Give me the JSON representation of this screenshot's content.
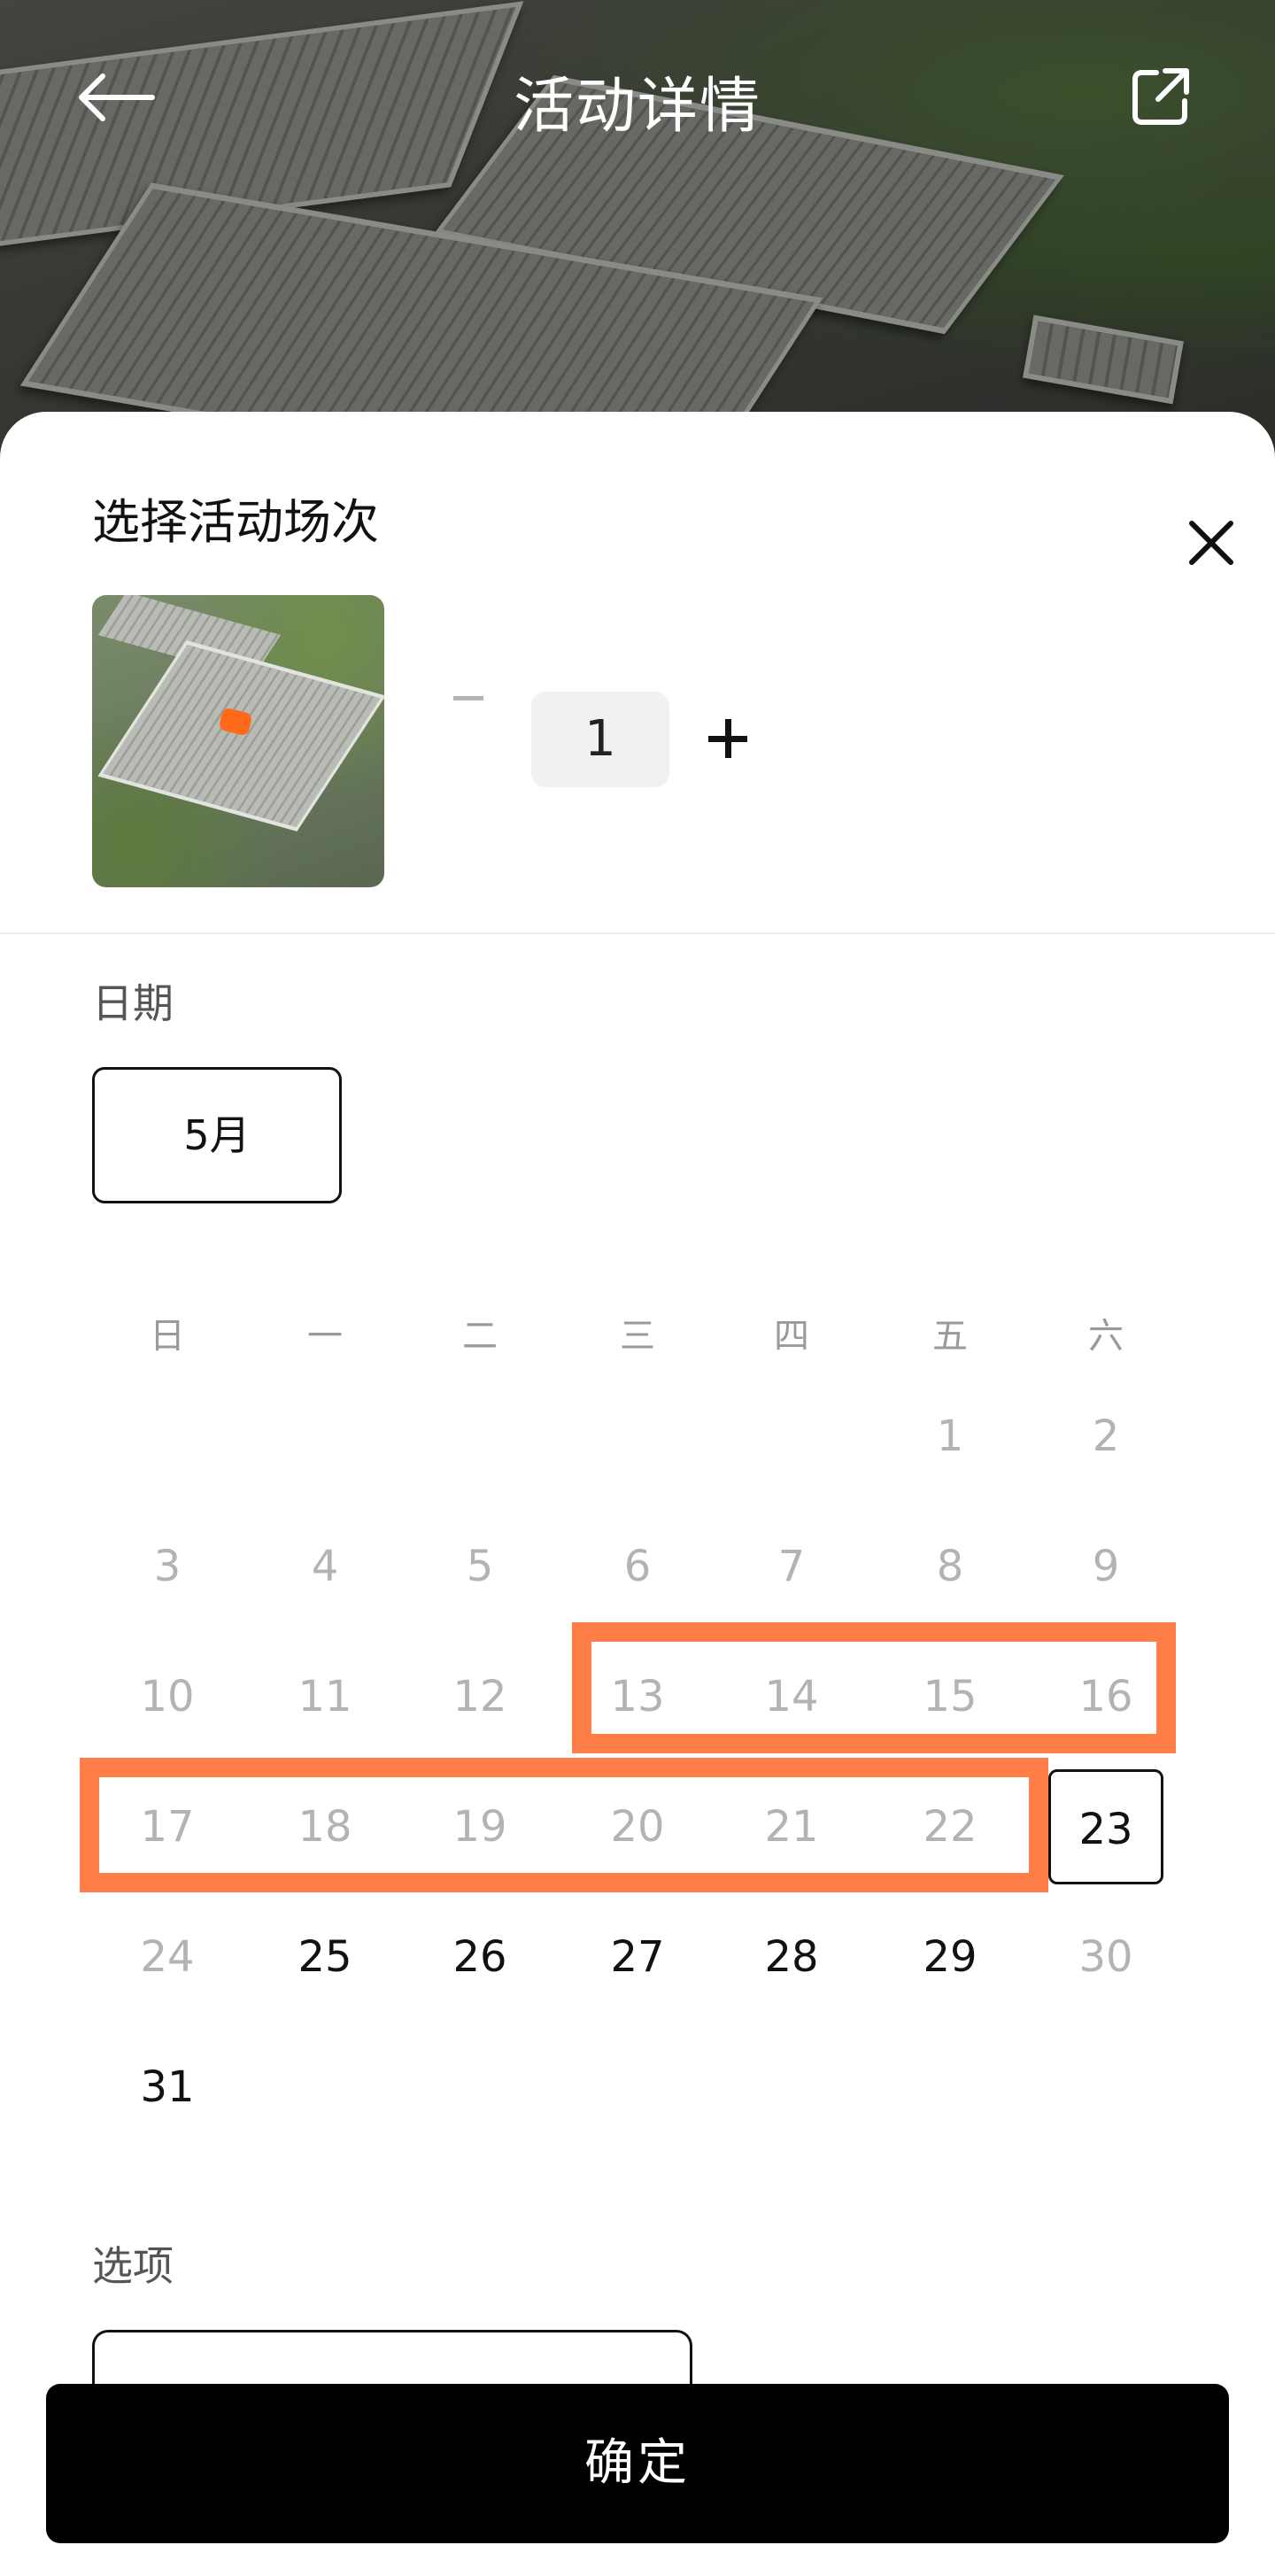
{
  "header": {
    "title": "活动详情",
    "back_icon": "arrow-left-icon",
    "share_icon": "share-external-icon"
  },
  "sheet": {
    "title": "选择活动场次",
    "close_icon": "close-icon",
    "quantity": {
      "minus_icon": "minus-icon",
      "value": "1",
      "plus_icon": "plus-icon"
    },
    "date_label": "日期",
    "month": "5月",
    "weekdays": [
      "日",
      "一",
      "二",
      "三",
      "四",
      "五",
      "六"
    ],
    "days": [
      {
        "label": "1",
        "state": "disabled"
      },
      {
        "label": "2",
        "state": "disabled"
      },
      {
        "label": "3",
        "state": "disabled"
      },
      {
        "label": "4",
        "state": "disabled"
      },
      {
        "label": "5",
        "state": "disabled"
      },
      {
        "label": "6",
        "state": "disabled"
      },
      {
        "label": "7",
        "state": "disabled"
      },
      {
        "label": "8",
        "state": "disabled"
      },
      {
        "label": "9",
        "state": "disabled"
      },
      {
        "label": "10",
        "state": "disabled"
      },
      {
        "label": "11",
        "state": "disabled"
      },
      {
        "label": "12",
        "state": "disabled"
      },
      {
        "label": "13",
        "state": "disabled"
      },
      {
        "label": "14",
        "state": "disabled"
      },
      {
        "label": "15",
        "state": "disabled"
      },
      {
        "label": "16",
        "state": "disabled"
      },
      {
        "label": "17",
        "state": "disabled"
      },
      {
        "label": "18",
        "state": "disabled"
      },
      {
        "label": "19",
        "state": "disabled"
      },
      {
        "label": "20",
        "state": "disabled"
      },
      {
        "label": "21",
        "state": "disabled"
      },
      {
        "label": "22",
        "state": "disabled"
      },
      {
        "label": "23",
        "state": "selected"
      },
      {
        "label": "24",
        "state": "disabled"
      },
      {
        "label": "25",
        "state": "available"
      },
      {
        "label": "26",
        "state": "available"
      },
      {
        "label": "27",
        "state": "available"
      },
      {
        "label": "28",
        "state": "available"
      },
      {
        "label": "29",
        "state": "available"
      },
      {
        "label": "30",
        "state": "disabled"
      },
      {
        "label": "31",
        "state": "available"
      }
    ],
    "first_weekday_index": 5,
    "highlight_color": "#ff7d46",
    "option_label": "选项",
    "confirm_label": "确定"
  }
}
